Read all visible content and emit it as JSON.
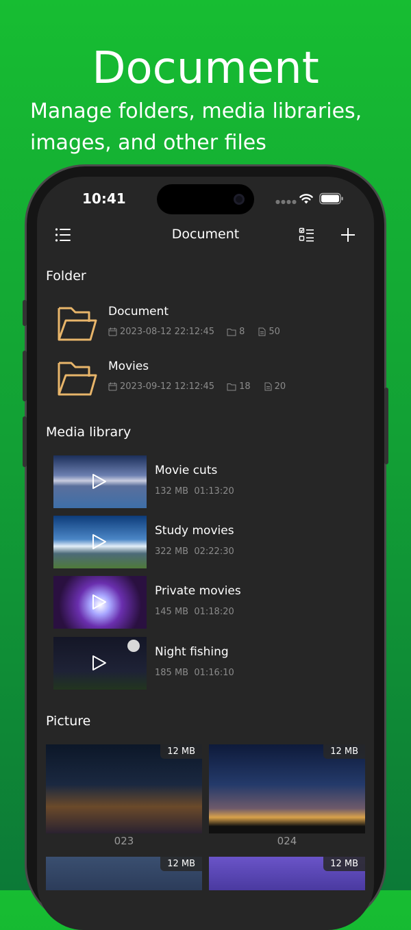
{
  "promo": {
    "title": "Document",
    "subtitle": "Manage folders, media libraries, images, and other files"
  },
  "status_bar": {
    "time": "10:41"
  },
  "navbar": {
    "title": "Document"
  },
  "sections": {
    "folder": "Folder",
    "media": "Media library",
    "picture": "Picture"
  },
  "folders": [
    {
      "name": "Document",
      "date": "2023-08-12 22:12:45",
      "subfolders": "8",
      "files": "50"
    },
    {
      "name": "Movies",
      "date": "2023-09-12 12:12:45",
      "subfolders": "18",
      "files": "20"
    }
  ],
  "media": [
    {
      "title": "Movie cuts",
      "size": "132 MB",
      "duration": "01:13:20"
    },
    {
      "title": "Study movies",
      "size": "322 MB",
      "duration": "02:22:30"
    },
    {
      "title": "Private movies",
      "size": "145 MB",
      "duration": "01:18:20"
    },
    {
      "title": "Night fishing",
      "size": "185 MB",
      "duration": "01:16:10"
    }
  ],
  "pictures": [
    {
      "name": "023",
      "size": "12 MB"
    },
    {
      "name": "024",
      "size": "12 MB"
    },
    {
      "name": "",
      "size": "12 MB"
    },
    {
      "name": "",
      "size": "12 MB"
    }
  ],
  "icons": {
    "menu": "list-menu-icon",
    "select": "checklist-icon",
    "add": "plus-icon",
    "folder": "folder-icon",
    "calendar": "calendar-icon",
    "subfolder": "subfolder-count-icon",
    "file": "file-count-icon",
    "play": "play-icon",
    "wifi": "wifi-icon",
    "battery": "battery-icon",
    "signal": "signal-dots-icon"
  },
  "colors": {
    "background_top": "#17bd32",
    "background_bottom": "#0c7a37",
    "screen": "#262626",
    "folder_accent": "#e8b56a"
  }
}
